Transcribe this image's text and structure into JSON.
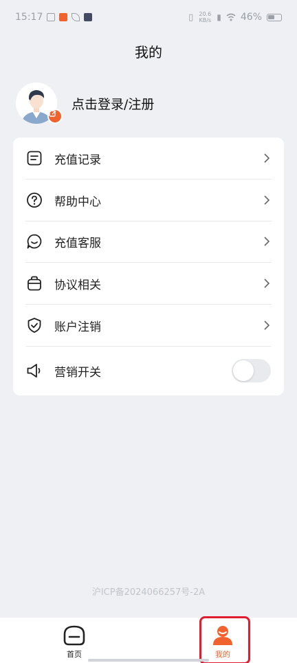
{
  "status_bar": {
    "time": "15:17",
    "network": "20.6 KB/s",
    "battery": "46%"
  },
  "page_title": "我的",
  "profile": {
    "login_text": "点击登录/注册"
  },
  "menu": [
    {
      "label": "充值记录",
      "icon": "document-icon"
    },
    {
      "label": "帮助中心",
      "icon": "question-icon"
    },
    {
      "label": "充值客服",
      "icon": "chat-icon"
    },
    {
      "label": "协议相关",
      "icon": "bag-icon"
    },
    {
      "label": "账户注销",
      "icon": "shield-icon"
    }
  ],
  "marketing_toggle": {
    "label": "营销开关",
    "enabled": false
  },
  "icp": "沪ICP备2024066257号-2A",
  "nav": {
    "home_label": "首页",
    "mine_label": "我的"
  },
  "colors": {
    "accent": "#f0632e",
    "background": "#eef0f3",
    "highlight": "#e01c2e"
  }
}
